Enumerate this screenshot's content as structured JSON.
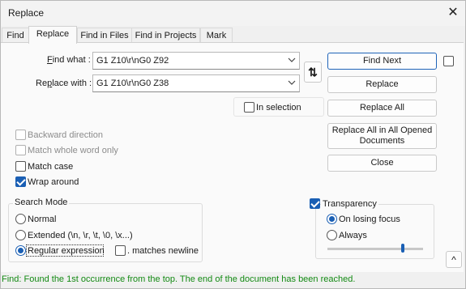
{
  "window": {
    "title": "Replace",
    "close_glyph": "✕"
  },
  "tabs": [
    {
      "label": "Find"
    },
    {
      "label": "Replace"
    },
    {
      "label": "Find in Files"
    },
    {
      "label": "Find in Projects"
    },
    {
      "label": "Mark"
    }
  ],
  "active_tab": "Replace",
  "find_what": {
    "label": "Find what :",
    "value": "G1 Z10\\r\\nG0 Z92"
  },
  "replace_with": {
    "label": "Replace with :",
    "value": "G1 Z10\\r\\nG0 Z38"
  },
  "swap_button": {
    "glyph": "⇅"
  },
  "in_selection": {
    "label": "In selection",
    "checked": false
  },
  "buttons": {
    "find_next": "Find Next",
    "replace": "Replace",
    "replace_all": "Replace All",
    "replace_all_opened_line1": "Replace All in All Opened",
    "replace_all_opened_line2": "Documents",
    "close": "Close"
  },
  "options": {
    "backward": {
      "label": "Backward direction",
      "checked": false,
      "enabled": false
    },
    "whole_word": {
      "label": "Match whole word only",
      "checked": false,
      "enabled": false
    },
    "match_case": {
      "label": "Match case",
      "checked": false,
      "enabled": true
    },
    "wrap_around": {
      "label": "Wrap around",
      "checked": true,
      "enabled": true
    }
  },
  "search_mode": {
    "title": "Search Mode",
    "normal": "Normal",
    "extended": "Extended (\\n, \\r, \\t, \\0, \\x...)",
    "regex": "Regular expression",
    "selected": "regex",
    "dot_newline": {
      "label": ". matches newline",
      "checked": false
    }
  },
  "transparency": {
    "label": "Transparency",
    "checked": true,
    "on_losing_focus": "On losing focus",
    "always": "Always",
    "selected": "on_losing_focus",
    "level": 0.8
  },
  "collapse_glyph": "^",
  "status": "Find: Found the 1st occurrence from the top. The end of the document has been reached.",
  "colors": {
    "accent": "#1a5fb4",
    "status_text": "#138a13"
  }
}
